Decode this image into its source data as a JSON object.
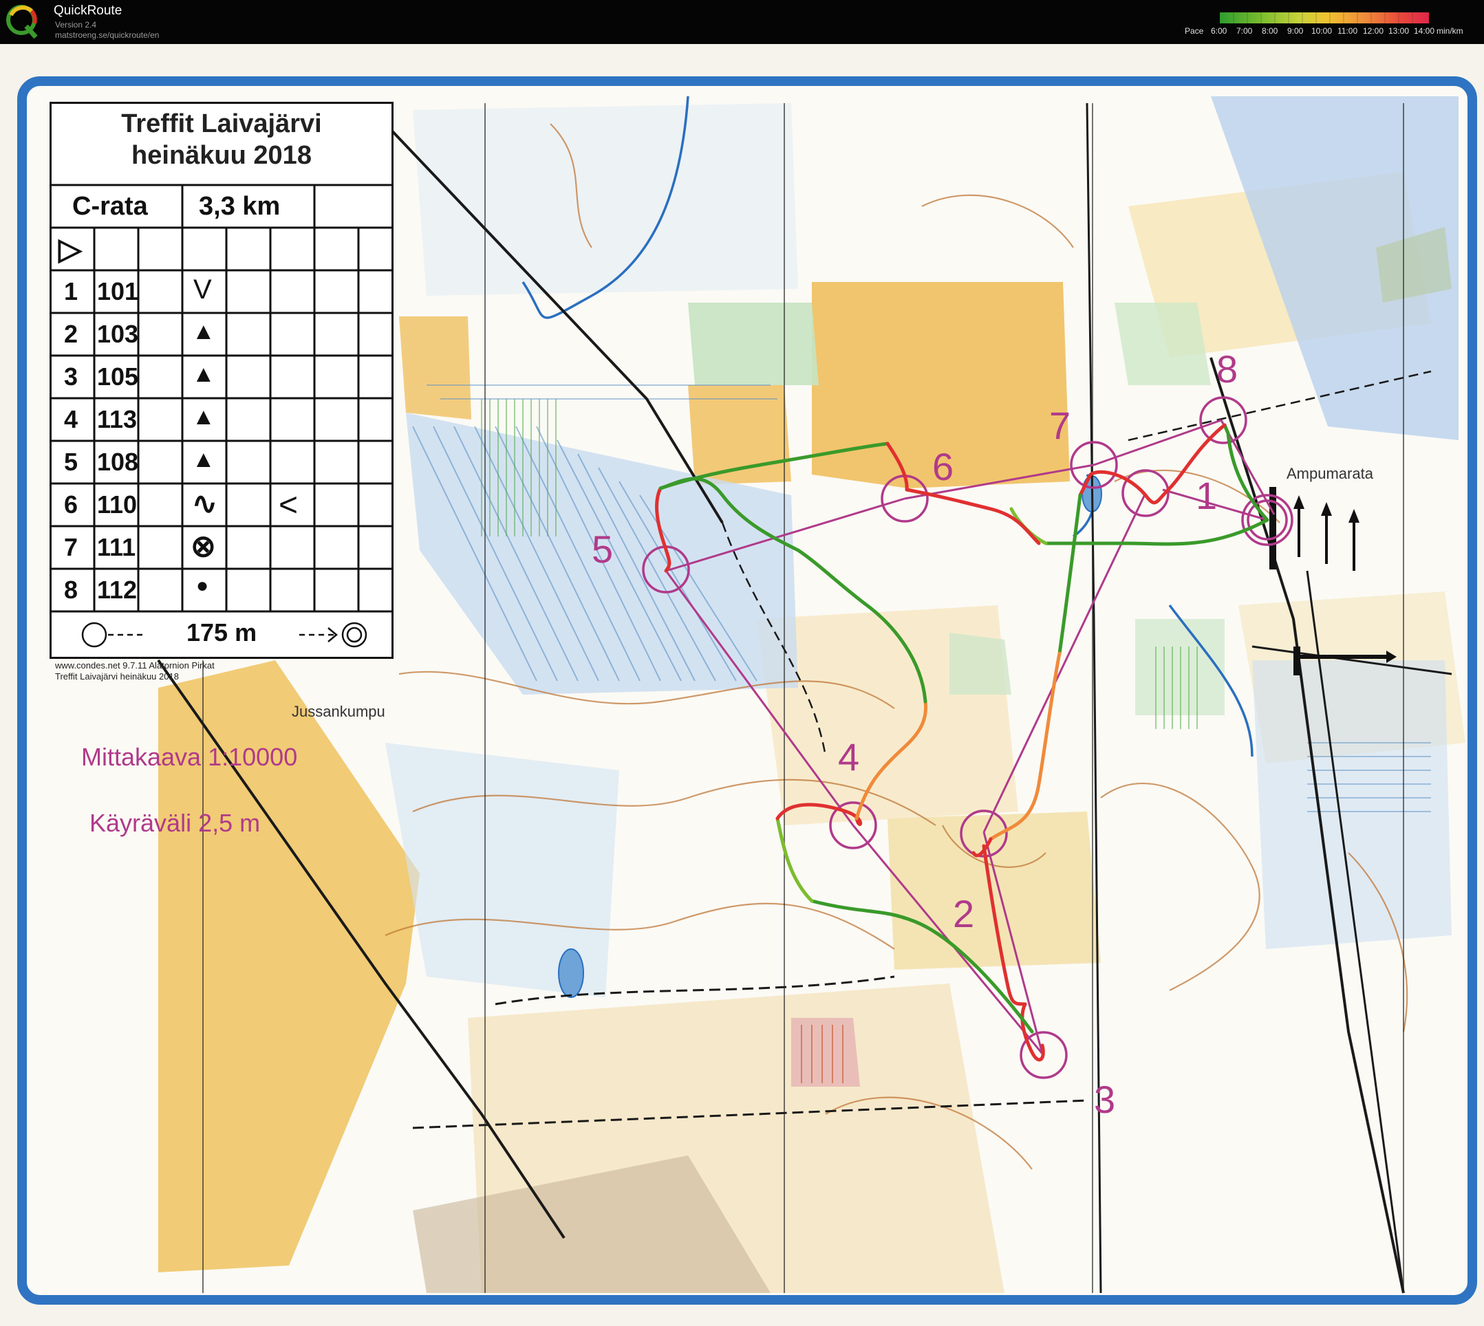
{
  "app": {
    "title": "QuickRoute",
    "version": "Version 2.4",
    "url": "matstroeng.se/quickroute/en"
  },
  "pace_legend": {
    "label": "Pace",
    "ticks": [
      "6:00",
      "7:00",
      "8:00",
      "9:00",
      "10:00",
      "11:00",
      "12:00",
      "13:00",
      "14:00"
    ],
    "unit": "min/km",
    "colors": [
      "#2e9d2e",
      "#7bbd2e",
      "#c8d23a",
      "#f1c232",
      "#f08a3a",
      "#e84a3a",
      "#e2264a"
    ]
  },
  "map": {
    "course_box": {
      "title_line1": "Treffit Laivajärvi",
      "title_line2": "heinäkuu 2018",
      "class": "C-rata",
      "length": "3,3 km",
      "start_symbol": "▷",
      "controls": [
        {
          "num": "1",
          "code": "101",
          "symbol": "V",
          "extra": ""
        },
        {
          "num": "2",
          "code": "103",
          "symbol": "▲",
          "extra": ""
        },
        {
          "num": "3",
          "code": "105",
          "symbol": "▲",
          "extra": ""
        },
        {
          "num": "4",
          "code": "113",
          "symbol": "▲",
          "extra": ""
        },
        {
          "num": "5",
          "code": "108",
          "symbol": "▲",
          "extra": ""
        },
        {
          "num": "6",
          "code": "110",
          "symbol": "∿",
          "extra": "<"
        },
        {
          "num": "7",
          "code": "111",
          "symbol": "⊗",
          "extra": ""
        },
        {
          "num": "8",
          "code": "112",
          "symbol": "●",
          "extra": ""
        }
      ],
      "finish_text": "175 m"
    },
    "credit_line1": "www.condes.net 9.7.11 Alatornion Pirkat",
    "credit_line2": "Treffit Laivajärvi heinäkuu 2018",
    "place_jussankumpu": "Jussankumpu",
    "place_ampumarata": "Ampumarata",
    "scale_text": "Mittakaava 1:10000",
    "contour_text": "Käyräväli 2,5 m",
    "control_numbers": [
      "1",
      "2",
      "3",
      "4",
      "5",
      "6",
      "7",
      "8"
    ]
  }
}
